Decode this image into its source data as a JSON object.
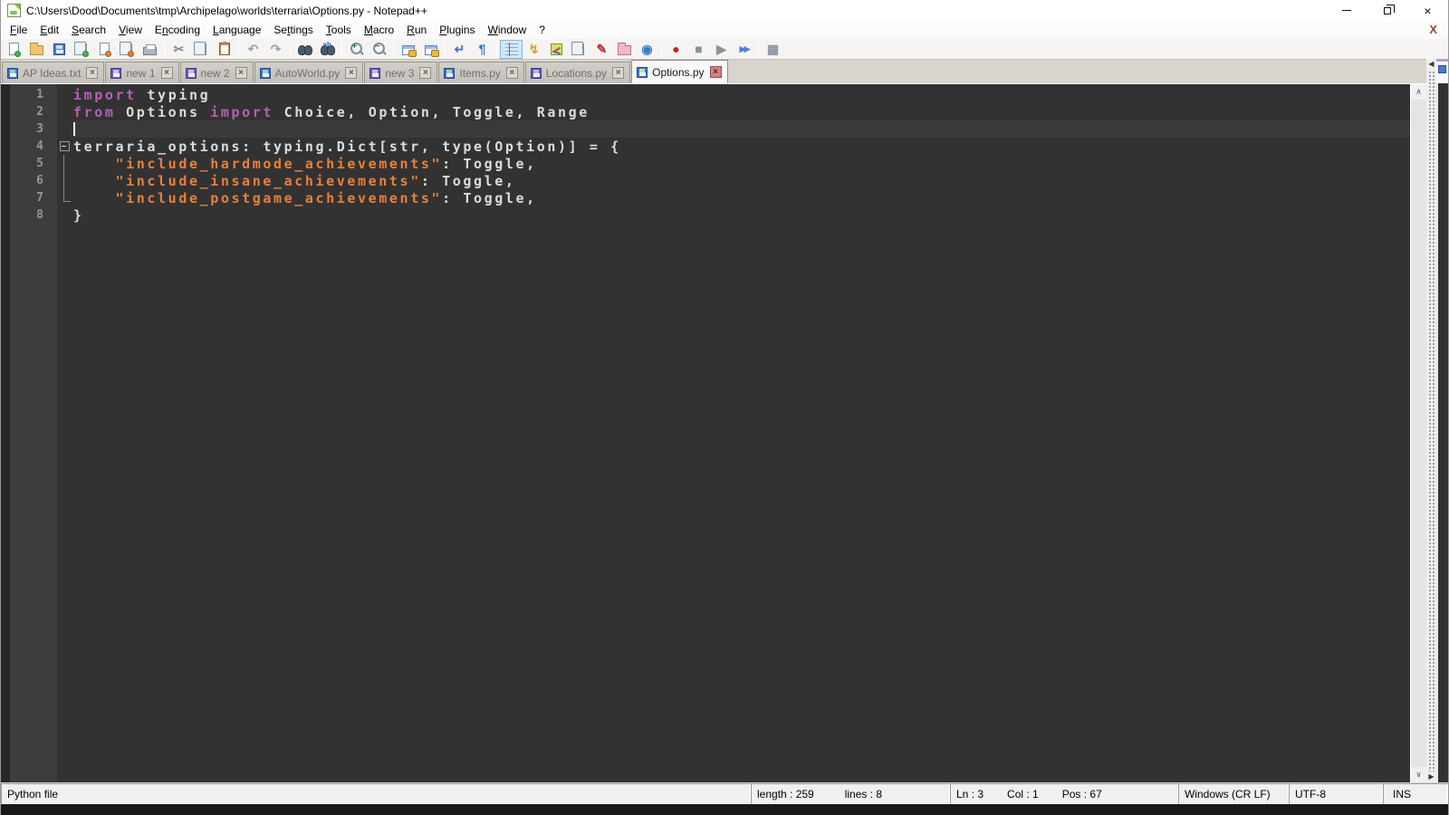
{
  "window": {
    "title": "C:\\Users\\Dood\\Documents\\tmp\\Archipelago\\worlds\\terraria\\Options.py - Notepad++",
    "menu_doc_close": "X"
  },
  "colors": {
    "keyword": "#b562b5",
    "string": "#e8803c",
    "plain": "#dcdcdc",
    "editor_bg": "#323232",
    "gutter_bg": "#3d3d3d",
    "active_tab_accent": "#b79ddb",
    "modified_floppy": "#6f58c9",
    "saved_floppy": "#3f6fd4",
    "record_red": "#cc2020"
  },
  "menu": {
    "items": [
      {
        "label": "File",
        "u": 0
      },
      {
        "label": "Edit",
        "u": 0
      },
      {
        "label": "Search",
        "u": 0
      },
      {
        "label": "View",
        "u": 0
      },
      {
        "label": "Encoding",
        "u": 1
      },
      {
        "label": "Language",
        "u": 0
      },
      {
        "label": "Settings",
        "u": 2
      },
      {
        "label": "Tools",
        "u": 0
      },
      {
        "label": "Macro",
        "u": 0
      },
      {
        "label": "Run",
        "u": 0
      },
      {
        "label": "Plugins",
        "u": 0
      },
      {
        "label": "Window",
        "u": 0
      },
      {
        "label": "?",
        "u": -1
      }
    ]
  },
  "toolbar": {
    "buttons": [
      {
        "name": "new-file-button",
        "kind": "doc",
        "badge": "#49b04f"
      },
      {
        "name": "open-file-button",
        "kind": "folder"
      },
      {
        "name": "save-button",
        "kind": "floppy"
      },
      {
        "name": "save-all-button",
        "kind": "docs",
        "badge": "#49b04f"
      },
      {
        "name": "close-button",
        "kind": "doc",
        "badge": "#e08030"
      },
      {
        "name": "close-all-button",
        "kind": "docs",
        "badge": "#e08030"
      },
      {
        "name": "print-button",
        "kind": "printer"
      },
      {
        "sep": true
      },
      {
        "name": "cut-button",
        "kind": "glyph",
        "glyph": "✂",
        "color": "#7e8ea0"
      },
      {
        "name": "copy-button",
        "kind": "docs"
      },
      {
        "name": "paste-button",
        "kind": "clip"
      },
      {
        "sep": true
      },
      {
        "name": "undo-button",
        "kind": "glyph",
        "glyph": "↶",
        "color": "#9aa4ae"
      },
      {
        "name": "redo-button",
        "kind": "glyph",
        "glyph": "↷",
        "color": "#9aa4ae"
      },
      {
        "sep": true
      },
      {
        "name": "find-button",
        "kind": "binoc"
      },
      {
        "name": "replace-button",
        "kind": "binoc",
        "sign": "ab"
      },
      {
        "sep": true
      },
      {
        "name": "zoom-in-button",
        "kind": "mag",
        "sign": "+",
        "signColor": "#2a8f2a"
      },
      {
        "name": "zoom-out-button",
        "kind": "mag",
        "sign": "−",
        "signColor": "#c03030"
      },
      {
        "sep": true
      },
      {
        "name": "sync-vertical-scroll-button",
        "kind": "lockwin"
      },
      {
        "name": "sync-horizontal-scroll-button",
        "kind": "lockwin"
      },
      {
        "sep": true
      },
      {
        "name": "word-wrap-button",
        "kind": "glyph",
        "glyph": "↵",
        "color": "#3a6fd0"
      },
      {
        "name": "show-all-characters-button",
        "kind": "glyph",
        "glyph": "¶",
        "color": "#3a6fd0"
      },
      {
        "sep": true
      },
      {
        "name": "indent-guide-button",
        "kind": "indent",
        "pressed": true
      },
      {
        "name": "function-list-button",
        "kind": "glyph",
        "glyph": "↯",
        "color": "#e0a020"
      },
      {
        "name": "document-map-button",
        "kind": "map"
      },
      {
        "name": "document-list-button",
        "kind": "docs"
      },
      {
        "name": "edit-popup-button",
        "kind": "glyph",
        "glyph": "✎",
        "color": "#c03030"
      },
      {
        "name": "folder-as-workspace-button",
        "kind": "folder",
        "pink": true
      },
      {
        "name": "monitoring-button",
        "kind": "glyph",
        "glyph": "◉",
        "color": "#3a77c9"
      },
      {
        "sep": true
      },
      {
        "name": "macro-record-button",
        "kind": "glyph",
        "glyph": "●",
        "color": "#cc2020"
      },
      {
        "name": "macro-stop-button",
        "kind": "glyph",
        "glyph": "■",
        "color": "#909090"
      },
      {
        "name": "macro-play-button",
        "kind": "glyph",
        "glyph": "▶",
        "color": "#909090"
      },
      {
        "name": "macro-run-multiple-button",
        "kind": "glyph",
        "glyph": "▶▶",
        "color": "#4a7fd4",
        "ff": true
      },
      {
        "sep": true
      },
      {
        "name": "macro-save-button",
        "kind": "glyph",
        "glyph": "▦",
        "color": "#8a95a5"
      }
    ]
  },
  "tabs": {
    "close_glyph": "×",
    "items": [
      {
        "label": "AP Ideas.txt",
        "floppy": "#3f6fd4",
        "shutter": "#8fd8cf",
        "active": false
      },
      {
        "label": "new 1",
        "floppy": "#6f58c9",
        "shutter": "#c9bde8",
        "active": false
      },
      {
        "label": "new 2",
        "floppy": "#6f58c9",
        "shutter": "#c9bde8",
        "active": false
      },
      {
        "label": "AutoWorld.py",
        "floppy": "#3f6fd4",
        "shutter": "#8fd8cf",
        "active": false
      },
      {
        "label": "new 3",
        "floppy": "#6f58c9",
        "shutter": "#c9bde8",
        "active": false
      },
      {
        "label": "Items.py",
        "floppy": "#3f6fd4",
        "shutter": "#9fd8a8",
        "active": false
      },
      {
        "label": "Locations.py",
        "floppy": "#5f5ec4",
        "shutter": "#b8b4e0",
        "active": false
      },
      {
        "label": "Options.py",
        "floppy": "#3f6fd4",
        "shutter": "#b8e8a0",
        "active": true
      }
    ]
  },
  "editor": {
    "lines": [
      {
        "n": 1,
        "fold": "",
        "tokens": [
          [
            "k",
            "import"
          ],
          [
            "p",
            " typing"
          ]
        ]
      },
      {
        "n": 2,
        "fold": "",
        "tokens": [
          [
            "k",
            "from"
          ],
          [
            "p",
            " Options "
          ],
          [
            "k",
            "import"
          ],
          [
            "p",
            " Choice, Option, Toggle, Range"
          ]
        ]
      },
      {
        "n": 3,
        "fold": "",
        "current": true,
        "caret": true,
        "tokens": []
      },
      {
        "n": 4,
        "fold": "box",
        "tokens": [
          [
            "p",
            "terraria_options: typing.Dict[str, type(Option)] = {"
          ]
        ]
      },
      {
        "n": 5,
        "fold": "v",
        "tokens": [
          [
            "p",
            "    "
          ],
          [
            "s",
            "\"include_hardmode_achievements\""
          ],
          [
            "p",
            ": Toggle,"
          ]
        ]
      },
      {
        "n": 6,
        "fold": "v",
        "tokens": [
          [
            "p",
            "    "
          ],
          [
            "s",
            "\"include_insane_achievements\""
          ],
          [
            "p",
            ": Toggle,"
          ]
        ]
      },
      {
        "n": 7,
        "fold": "corner",
        "tokens": [
          [
            "p",
            "    "
          ],
          [
            "s",
            "\"include_postgame_achievements\""
          ],
          [
            "p",
            ": Toggle,"
          ]
        ]
      },
      {
        "n": 8,
        "fold": "",
        "tokens": [
          [
            "p",
            "}"
          ]
        ]
      }
    ],
    "scroll_up_glyph": "∧",
    "scroll_down_glyph": "∨",
    "splitter_left_glyph": "◀",
    "splitter_right_glyph": "▶"
  },
  "status": {
    "doc_type": "Python file",
    "length": "length : 259",
    "lines": "lines : 8",
    "ln": "Ln : 3",
    "col": "Col : 1",
    "pos": "Pos : 67",
    "eol": "Windows (CR LF)",
    "encoding": "UTF-8",
    "mode": "INS"
  }
}
